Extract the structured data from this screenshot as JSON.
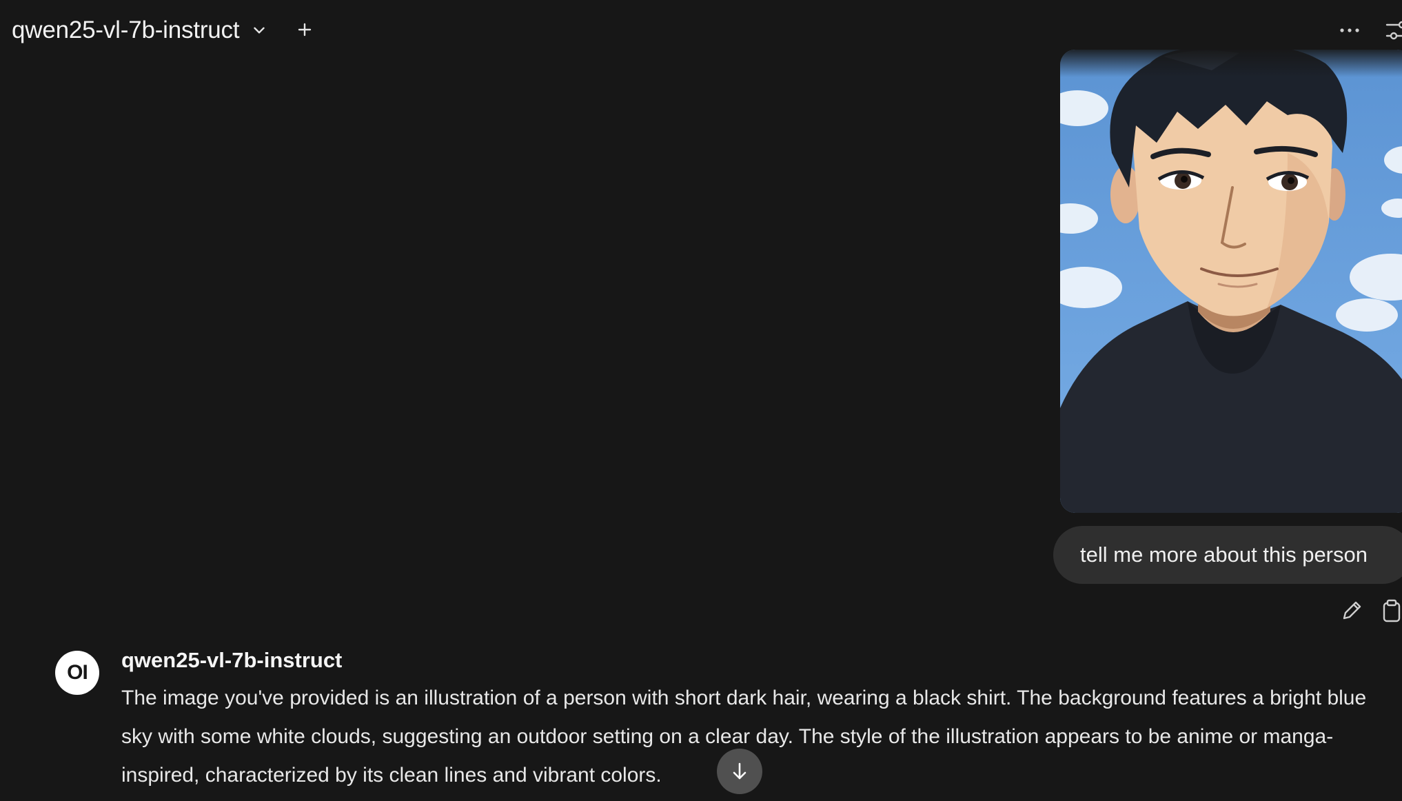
{
  "header": {
    "model_name": "qwen25-vl-7b-instruct"
  },
  "icons": {
    "chevron": "chevron-down-icon",
    "new_chat": "plus-icon",
    "more": "ellipsis-icon",
    "settings": "sliders-icon",
    "edit": "pencil-icon",
    "copy": "clipboard-icon",
    "scroll": "arrow-down-icon"
  },
  "user_message": {
    "image_subject": "anime-style portrait of a man with short dark hair in a black t-shirt against a blue sky",
    "text": "tell me more about this person"
  },
  "assistant_message": {
    "avatar_text": "OI",
    "model_name": "qwen25-vl-7b-instruct",
    "text": "The image you've provided is an illustration of a person with short dark hair, wearing a black shirt. The background features a bright blue sky with some white clouds, suggesting an outdoor setting on a clear day. The style of the illustration appears to be anime or manga-inspired, characterized by its clean lines and vibrant colors."
  },
  "colors": {
    "background": "#171717",
    "bubble": "#2f2f2f",
    "text": "#ececec"
  }
}
